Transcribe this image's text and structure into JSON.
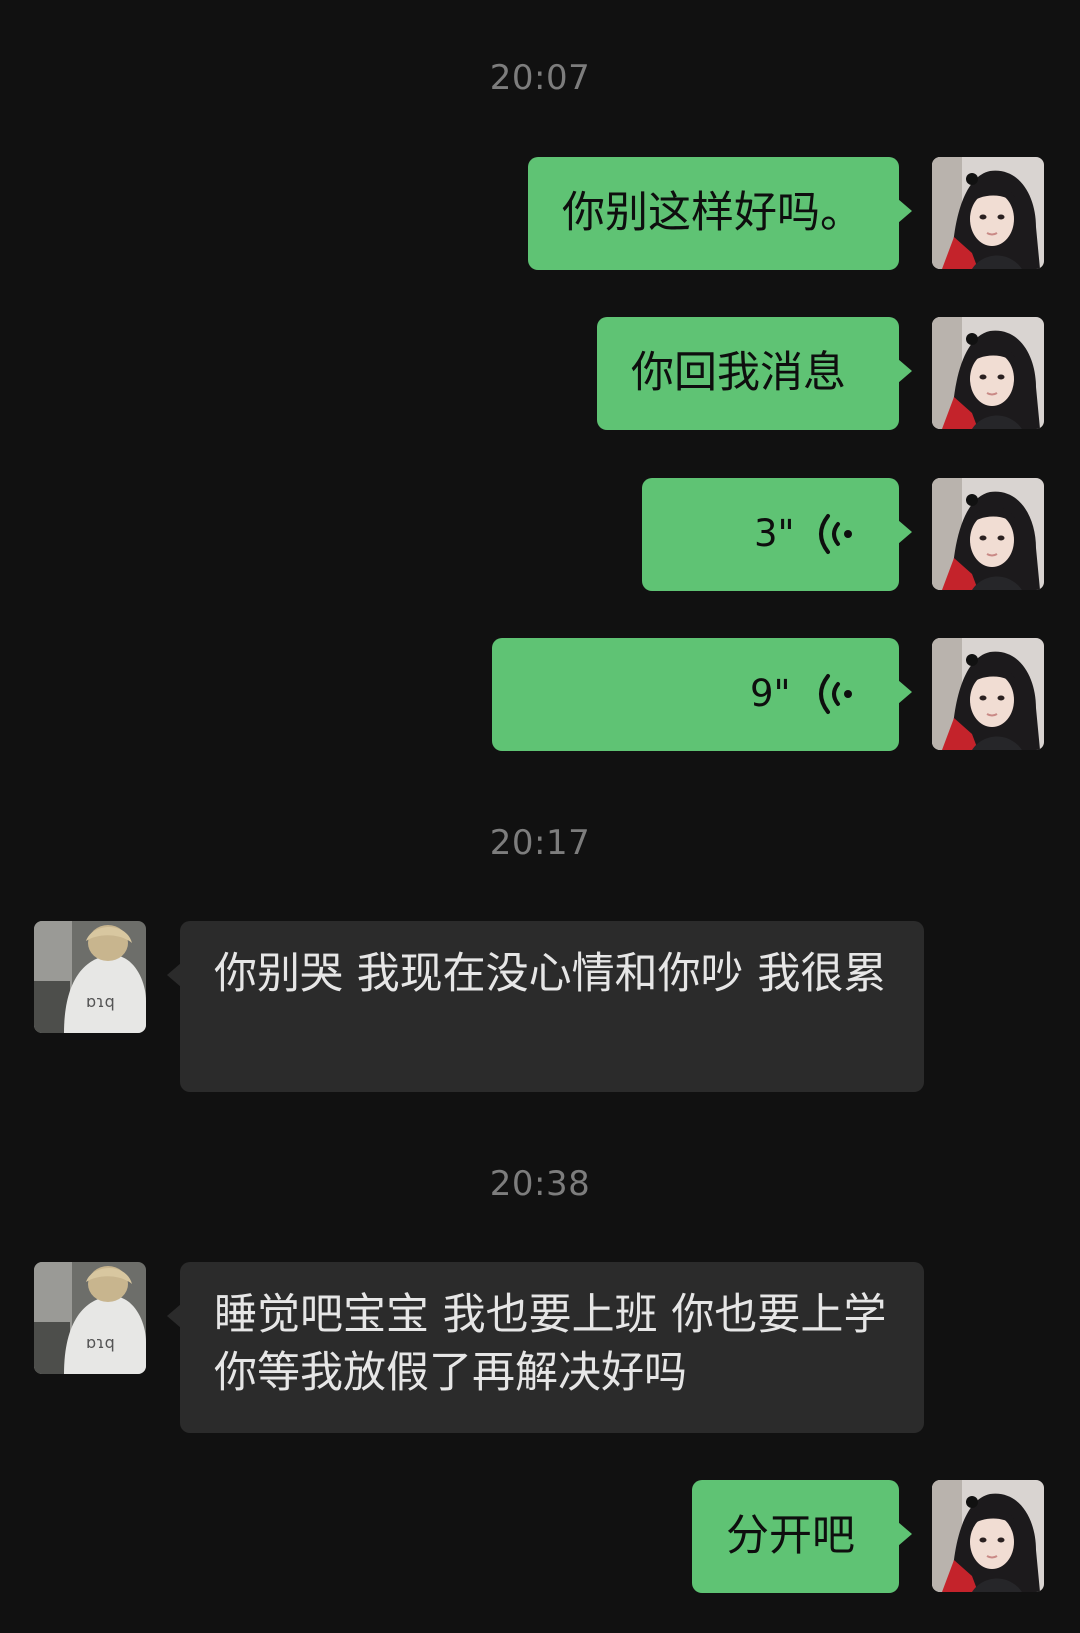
{
  "colors": {
    "background": "#111111",
    "sent_bubble": "#5fc374",
    "received_bubble": "#2b2b2b",
    "timestamp": "#7d7d7d"
  },
  "timestamps": [
    "20:07",
    "20:17",
    "20:38"
  ],
  "messages": [
    {
      "side": "sent",
      "kind": "text",
      "text": "你别这样好吗。"
    },
    {
      "side": "sent",
      "kind": "text",
      "text": "你回我消息"
    },
    {
      "side": "sent",
      "kind": "voice",
      "duration": "3\"",
      "icon": "voice-wave-icon"
    },
    {
      "side": "sent",
      "kind": "voice",
      "duration": "9\"",
      "icon": "voice-wave-icon"
    },
    {
      "side": "received",
      "kind": "text",
      "text": "你别哭 我现在没心情和你吵 我很累"
    },
    {
      "side": "received",
      "kind": "text",
      "text": "睡觉吧宝宝 我也要上班 你也要上学你等我放假了再解决好吗"
    },
    {
      "side": "sent",
      "kind": "text",
      "text": "分开吧"
    }
  ]
}
